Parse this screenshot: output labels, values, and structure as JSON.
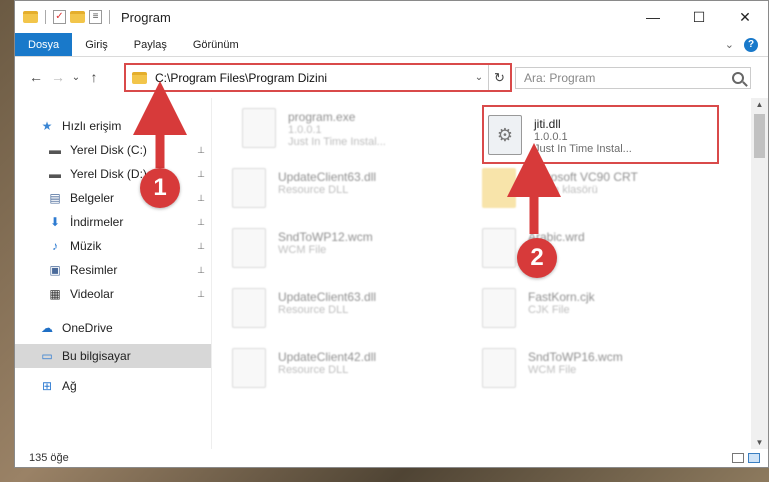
{
  "window": {
    "title": "Program",
    "controls": {
      "minimize": "—",
      "maximize": "☐",
      "close": "✕"
    }
  },
  "ribbon": {
    "tabs": [
      "Dosya",
      "Giriş",
      "Paylaş",
      "Görünüm"
    ],
    "active_tab": "Dosya",
    "expand_glyph": "⌄",
    "help_glyph": "?"
  },
  "navigation": {
    "back": "←",
    "forward": "→",
    "recent": "⌄",
    "up": "↑"
  },
  "address": {
    "path": "C:\\Program Files\\Program Dizini",
    "chevron": "⌄",
    "refresh": "↻"
  },
  "search": {
    "placeholder": "Ara: Program"
  },
  "sidebar": {
    "items": [
      {
        "label": "Hızlı erişim",
        "icon": "star-icon",
        "glyph": "★",
        "color": "#3a86d4"
      },
      {
        "label": "Yerel Disk (C:)",
        "icon": "drive-icon",
        "glyph": "▬",
        "color": "#555555",
        "pinned": true
      },
      {
        "label": "Yerel Disk (D:)",
        "icon": "drive-icon",
        "glyph": "▬",
        "color": "#555555",
        "pinned": true
      },
      {
        "label": "Belgeler",
        "icon": "document-icon",
        "glyph": "▤",
        "color": "#4a6a9a",
        "pinned": true
      },
      {
        "label": "İndirmeler",
        "icon": "download-icon",
        "glyph": "⬇",
        "color": "#2e7bd1",
        "pinned": true
      },
      {
        "label": "Müzik",
        "icon": "music-icon",
        "glyph": "♪",
        "color": "#2e7bd1",
        "pinned": true
      },
      {
        "label": "Resimler",
        "icon": "pictures-icon",
        "glyph": "▣",
        "color": "#4a6a9a",
        "pinned": true
      },
      {
        "label": "Videolar",
        "icon": "video-icon",
        "glyph": "▦",
        "color": "#333333",
        "pinned": true
      },
      {
        "label": "OneDrive",
        "icon": "cloud-icon",
        "glyph": "☁",
        "color": "#1f6fc5"
      },
      {
        "label": "Bu bilgisayar",
        "icon": "computer-icon",
        "glyph": "▭",
        "color": "#2e7bd1",
        "selected": true
      },
      {
        "label": "Ağ",
        "icon": "network-icon",
        "glyph": "⊞",
        "color": "#2e7bd1"
      }
    ],
    "pin_glyph": "📌"
  },
  "files": [
    {
      "name": "program.exe",
      "desc1": "1.0.0.1",
      "desc2": "Just In Time Instal...",
      "type": "exe"
    },
    {
      "name": "UpdateClient63.dll",
      "desc1": "Resource DLL",
      "type": "dll"
    },
    {
      "name": "Microsoft VC90 CRT",
      "desc1": "Dosya klasörü",
      "type": "folder",
      "note": "partially hidden by arrow"
    },
    {
      "name": "SndToWP12.wcm",
      "desc1": "WCM File",
      "type": "file"
    },
    {
      "name": "Arabic.wrd",
      "desc1": "",
      "type": "file"
    },
    {
      "name": "UpdateClient63.dll",
      "desc1": "Resource DLL",
      "type": "dll"
    },
    {
      "name": "FastKorn.cjk",
      "desc1": "CJK File",
      "type": "file"
    },
    {
      "name": "UpdateClient42.dll",
      "desc1": "Resource DLL",
      "type": "dll"
    },
    {
      "name": "SndToWP16.wcm",
      "desc1": "WCM File",
      "type": "file"
    }
  ],
  "highlighted_file": {
    "name": "jiti.dll",
    "desc1": "1.0.0.1",
    "desc2": "Just In Time Instal..."
  },
  "status": {
    "count": "135 öğe"
  },
  "annotations": {
    "step1": "1",
    "step2": "2",
    "color": "#d73a3a"
  }
}
